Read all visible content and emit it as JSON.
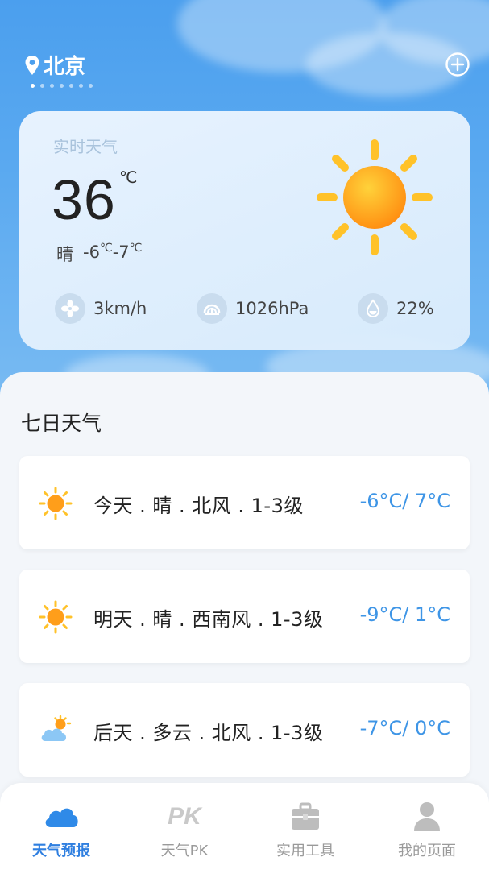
{
  "header": {
    "city": "北京",
    "page_count": 7,
    "active_page": 0
  },
  "current": {
    "title": "实时天气",
    "temperature": "36",
    "unit": "℃",
    "condition": "晴",
    "low": "-6",
    "high": "-7",
    "deg": "℃",
    "wind": "3km/h",
    "pressure": "1026hPa",
    "humidity": "22%"
  },
  "forecast": {
    "title": "七日天气",
    "days": [
      {
        "desc": "今天 . 晴 . 北风 . 1-3级",
        "temp": "-6°C/ 7°C",
        "icon": "sun-icon"
      },
      {
        "desc": "明天 . 晴 . 西南风 . 1-3级",
        "temp": "-9°C/ 1°C",
        "icon": "sun-icon"
      },
      {
        "desc": "后天 . 多云 . 北风 . 1-3级",
        "temp": "-7°C/ 0°C",
        "icon": "cloudy-icon"
      }
    ]
  },
  "tabs": [
    {
      "label": "天气预报",
      "icon": "cloud-icon",
      "active": true
    },
    {
      "label": "天气PK",
      "icon": "pk-icon",
      "active": false
    },
    {
      "label": "实用工具",
      "icon": "toolbox-icon",
      "active": false
    },
    {
      "label": "我的页面",
      "icon": "user-icon",
      "active": false
    }
  ],
  "colors": {
    "accent": "#2f7fe0",
    "temp_blue": "#3e95e6",
    "sun": "#ffa21a"
  }
}
